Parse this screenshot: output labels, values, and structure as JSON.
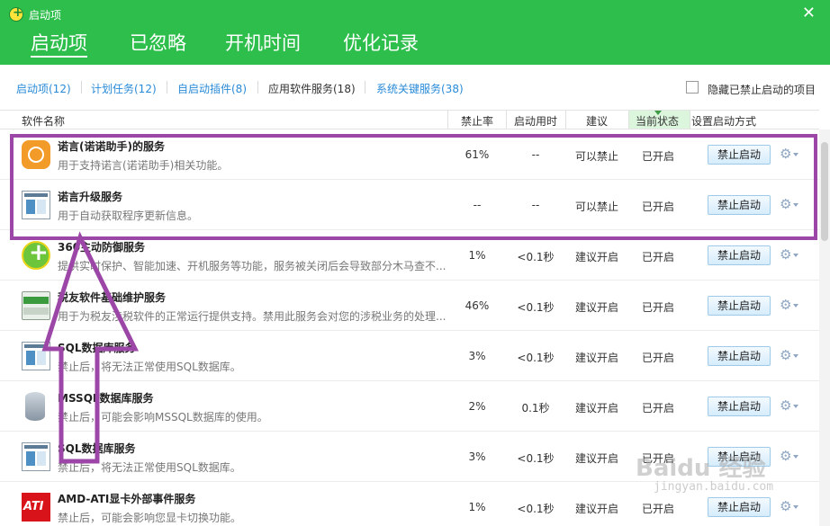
{
  "window": {
    "title": "启动项",
    "close_icon": "close-icon"
  },
  "main_tabs": [
    {
      "label": "启动项",
      "active": true
    },
    {
      "label": "已忽略"
    },
    {
      "label": "开机时间"
    },
    {
      "label": "优化记录"
    }
  ],
  "sub_tabs": [
    {
      "label": "启动项(12)"
    },
    {
      "label": "计划任务(12)"
    },
    {
      "label": "自启动插件(8)"
    },
    {
      "label": "应用软件服务(18)",
      "active": true
    },
    {
      "label": "系统关键服务(38)"
    }
  ],
  "hide_disabled": {
    "label": "隐藏已禁止启动的项目",
    "checked": false
  },
  "columns": {
    "name": "软件名称",
    "rate": "禁止率",
    "time": "启动用时",
    "advice": "建议",
    "state": "当前状态",
    "action": "设置启动方式"
  },
  "rows": [
    {
      "icon": "nuonuo-icon",
      "name": "诺言(诺诺助手)的服务",
      "desc": "用于支持诺言(诺诺助手)相关功能。",
      "rate": "61%",
      "time": "--",
      "advice": "可以禁止",
      "state": "已开启",
      "button": "禁止启动"
    },
    {
      "icon": "window-icon",
      "name": "诺言升级服务",
      "desc": "用于自动获取程序更新信息。",
      "rate": "--",
      "time": "--",
      "advice": "可以禁止",
      "state": "已开启",
      "button": "禁止启动"
    },
    {
      "icon": "360-icon",
      "name": "360主动防御服务",
      "desc": "提供实时保护、智能加速、开机服务等功能，服务被关闭后会导致部分木马查不...",
      "rate": "1%",
      "time": "<0.1秒",
      "advice": "建议开启",
      "state": "已开启",
      "button": "禁止启动"
    },
    {
      "icon": "tax-icon",
      "name": "税友软件基础维护服务",
      "desc": "用于为税友涉税软件的正常运行提供支持。禁用此服务会对您的涉税业务的处理...",
      "rate": "46%",
      "time": "<0.1秒",
      "advice": "建议开启",
      "state": "已开启",
      "button": "禁止启动"
    },
    {
      "icon": "window-icon",
      "name": "SQL数据库服务",
      "desc": "禁止后，将无法正常使用SQL数据库。",
      "rate": "3%",
      "time": "<0.1秒",
      "advice": "建议开启",
      "state": "已开启",
      "button": "禁止启动"
    },
    {
      "icon": "database-icon",
      "name": "MSSQL数据库服务",
      "desc": "禁止后，可能会影响MSSQL数据库的使用。",
      "rate": "2%",
      "time": "0.1秒",
      "advice": "建议开启",
      "state": "已开启",
      "button": "禁止启动"
    },
    {
      "icon": "window-icon",
      "name": "SQL数据库服务",
      "desc": "禁止后，将无法正常使用SQL数据库。",
      "rate": "3%",
      "time": "<0.1秒",
      "advice": "建议开启",
      "state": "已开启",
      "button": "禁止启动"
    },
    {
      "icon": "ati-icon",
      "name": "AMD-ATI显卡外部事件服务",
      "desc": "禁止后，可能会影响您显卡切换功能。",
      "rate": "1%",
      "time": "<0.1秒",
      "advice": "建议开启",
      "state": "已开启",
      "button": "禁止启动"
    }
  ],
  "annotation": {
    "color": "#9c47a7"
  },
  "watermark": {
    "text": "Baidu 经验",
    "sub": "jingyan.baidu.com"
  },
  "colors": {
    "header": "#2dbe4b",
    "link": "#2a8bd8"
  }
}
